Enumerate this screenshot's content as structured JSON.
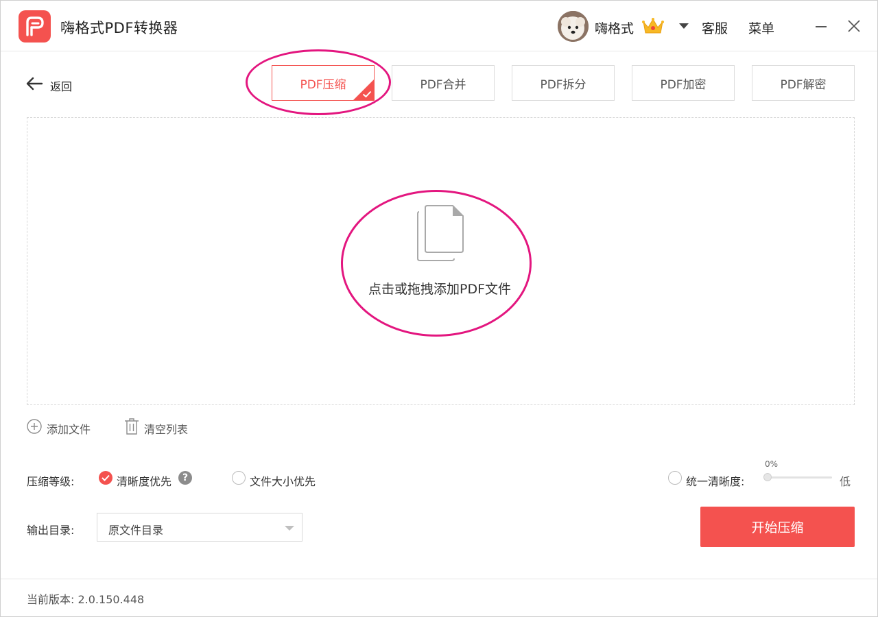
{
  "app": {
    "title": "嗨格式PDF转换器",
    "logo_icon": "pdf-converter-logo-icon",
    "brand_color": "#f4524f"
  },
  "header": {
    "username": "嗨格式",
    "vip_icon": "crown-icon",
    "service_label": "客服",
    "menu_label": "菜单"
  },
  "nav": {
    "back_label": "返回"
  },
  "tabs": [
    {
      "label": "PDF压缩",
      "active": true
    },
    {
      "label": "PDF合并",
      "active": false
    },
    {
      "label": "PDF拆分",
      "active": false
    },
    {
      "label": "PDF加密",
      "active": false
    },
    {
      "label": "PDF解密",
      "active": false
    }
  ],
  "dropzone": {
    "text": "点击或拖拽添加PDF文件",
    "icon": "document-stack-icon"
  },
  "file_actions": {
    "add_label": "添加文件",
    "clear_label": "清空列表"
  },
  "compression": {
    "level_label": "压缩等级:",
    "option_clarity": "清晰度优先",
    "option_size": "文件大小优先",
    "selected": "清晰度优先",
    "help_symbol": "?",
    "uniform_label": "统一清晰度:",
    "slider_value": "0%",
    "slider_fraction": 0,
    "slider_low_label": "低"
  },
  "output": {
    "label": "输出目录:",
    "selected": "原文件目录"
  },
  "start_button": "开始压缩",
  "footer": {
    "version": "当前版本: 2.0.150.448"
  },
  "annotation_color": "#e3167f"
}
